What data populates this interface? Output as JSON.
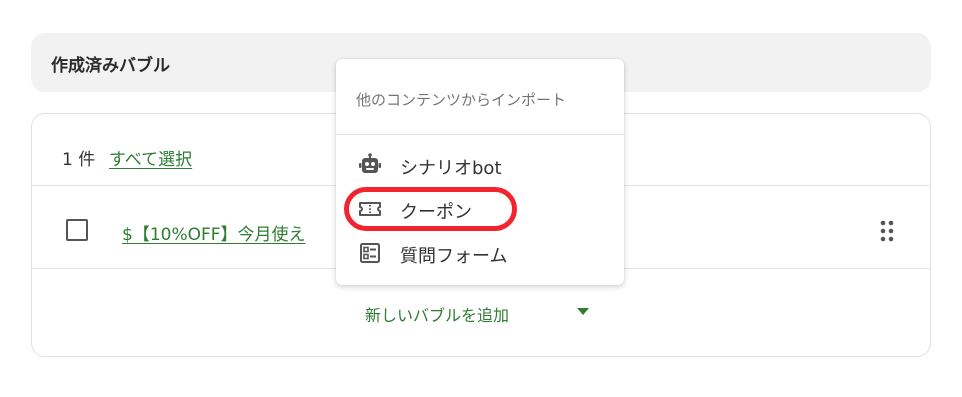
{
  "section": {
    "title": "作成済みバブル"
  },
  "list": {
    "count": "1 件",
    "select_all": "すべて選択",
    "bubble_title": "$【10%OFF】今月使え",
    "add_label": "新しいバブルを追加"
  },
  "dropdown": {
    "header": "他のコンテンツからインポート",
    "items": [
      {
        "label": "シナリオbot",
        "icon": "robot-icon"
      },
      {
        "label": "クーポン",
        "icon": "ticket-icon"
      },
      {
        "label": "質問フォーム",
        "icon": "form-icon"
      }
    ]
  },
  "colors": {
    "accent": "#2e7d32",
    "highlight": "#f2252e"
  }
}
